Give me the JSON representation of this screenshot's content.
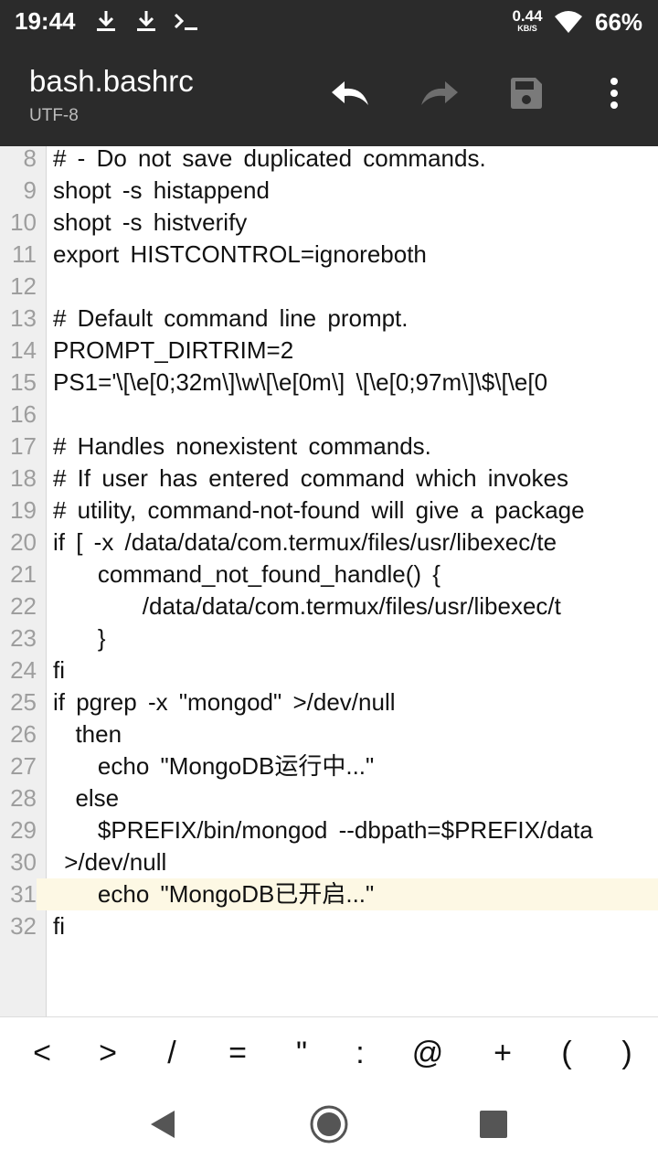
{
  "status_bar": {
    "time": "19:44",
    "notification_icons": [
      "download-icon",
      "download-icon",
      "terminal-icon"
    ],
    "net_speed_value": "0.44",
    "net_speed_unit": "KB/S",
    "battery": "66%"
  },
  "app_bar": {
    "file_name": "bash.bashrc",
    "encoding": "UTF-8",
    "actions": [
      "undo-icon",
      "redo-icon",
      "save-icon",
      "more-icon"
    ]
  },
  "editor": {
    "current_line": 31,
    "lines": [
      {
        "n": "8",
        "text": "# - Do not save duplicated commands."
      },
      {
        "n": "9",
        "text": "shopt -s histappend"
      },
      {
        "n": "10",
        "text": "shopt -s histverify"
      },
      {
        "n": "11",
        "text": "export HISTCONTROL=ignoreboth"
      },
      {
        "n": "12",
        "text": ""
      },
      {
        "n": "13",
        "text": "# Default command line prompt."
      },
      {
        "n": "14",
        "text": "PROMPT_DIRTRIM=2"
      },
      {
        "n": "15",
        "text": "PS1='\\[\\e[0;32m\\]\\w\\[\\e[0m\\] \\[\\e[0;97m\\]\\$\\[\\e[0"
      },
      {
        "n": "16",
        "text": ""
      },
      {
        "n": "17",
        "text": "# Handles nonexistent commands."
      },
      {
        "n": "18",
        "text": "# If user has entered command which invokes"
      },
      {
        "n": "19",
        "text": "# utility, command-not-found will give a package"
      },
      {
        "n": "20",
        "text": "if [ -x /data/data/com.termux/files/usr/libexec/te"
      },
      {
        "n": "21",
        "text": "    command_not_found_handle() {"
      },
      {
        "n": "22",
        "text": "        /data/data/com.termux/files/usr/libexec/t"
      },
      {
        "n": "23",
        "text": "    }"
      },
      {
        "n": "24",
        "text": "fi"
      },
      {
        "n": "25",
        "text": "if pgrep -x \"mongod\" >/dev/null"
      },
      {
        "n": "26",
        "text": "  then"
      },
      {
        "n": "27",
        "text": "    echo \"MongoDB运行中...\""
      },
      {
        "n": "28",
        "text": "  else"
      },
      {
        "n": "29",
        "text": "    $PREFIX/bin/mongod --dbpath=$PREFIX/data"
      },
      {
        "n": "30",
        "text": " >/dev/null"
      },
      {
        "n": "31",
        "text": "    echo \"MongoDB已开启...\""
      },
      {
        "n": "32",
        "text": "fi"
      }
    ]
  },
  "symbol_bar": {
    "keys": [
      "<",
      ">",
      "/",
      "=",
      "\"",
      ":",
      "@",
      "+",
      "(",
      ")"
    ]
  },
  "nav_bar": {
    "buttons": [
      "back-icon",
      "home-icon",
      "recents-icon"
    ]
  }
}
